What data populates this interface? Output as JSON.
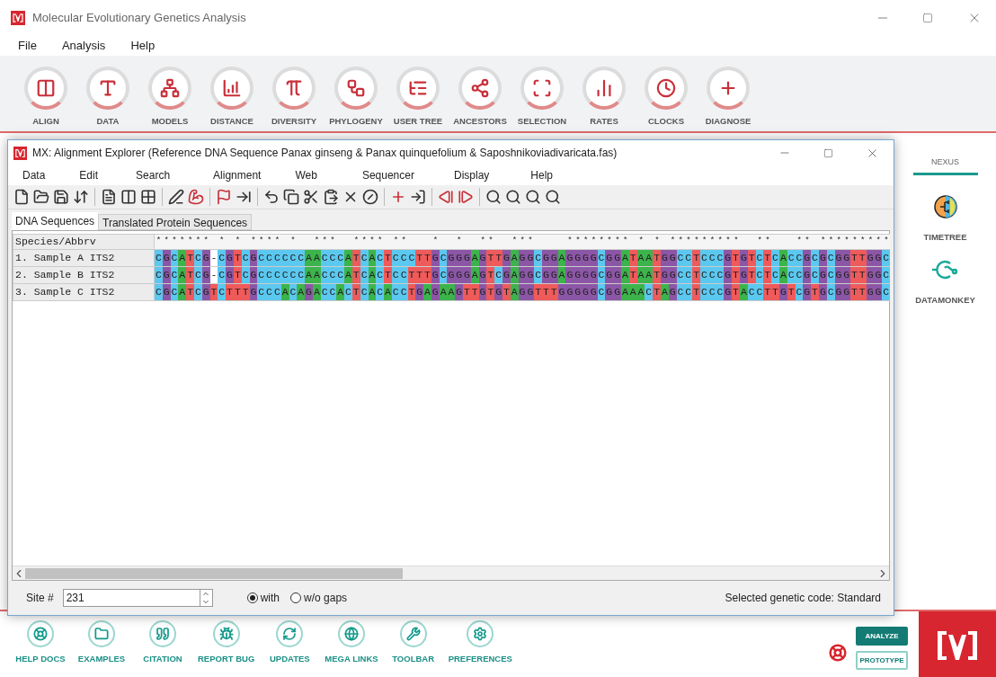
{
  "app": {
    "title": "Molecular Evolutionary Genetics Analysis",
    "menu": [
      "File",
      "Analysis",
      "Help"
    ],
    "tools": [
      "ALIGN",
      "DATA",
      "MODELS",
      "DISTANCE",
      "DIVERSITY",
      "PHYLOGENY",
      "USER TREE",
      "ANCESTORS",
      "SELECTION",
      "RATES",
      "CLOCKS",
      "DIAGNOSE"
    ]
  },
  "explorer": {
    "title": "MX: Alignment Explorer (Reference DNA Sequence Panax ginseng & Panax quinquefolium & Saposhnikoviadivaricata.fas)",
    "menu": [
      "Data",
      "Edit",
      "Search",
      "Alignment",
      "Web",
      "Sequencer",
      "Display",
      "Help"
    ],
    "tabs": [
      {
        "label": "DNA Sequences",
        "selected": true
      },
      {
        "label": "Translated Protein Sequences",
        "selected": false
      }
    ],
    "header": "Species/Abbrv",
    "conservation": "******* * * **** *  ***  **** **   *  *  **  ***    ******** * * *********  **   ** *********",
    "rows": [
      {
        "name": "1. Sample A ITS2",
        "sequence": "CGCATCG-CGTCGCCCCCCAACCCATCACTCCCTTGCGGGAGTTGAGGCGGAGGGGCGGATAATGGCCTCCCGTGTCTCACCGCGCGGTTGGC"
      },
      {
        "name": "2. Sample B ITS2",
        "sequence": "CGCATCG-CGTCGCCCCCCAACCCATCACTCCTTTGCGGGAGTCGAGGCGGAGGGGCGGATAATGGCCTCCCGTGTCTCACCGCGCGGTTGGC"
      },
      {
        "name": "3. Sample C ITS2",
        "sequence": "CGCATCGTCTTTGCCCACAGACCACTCACACCTGAGAAGTTGTGTAGGTTTGGGGGCGGAAACTAGCCTCCCGTACCTTGTCGTGCGGTTGGC"
      }
    ],
    "site_label": "Site #",
    "site_value": "231",
    "gap_options": [
      {
        "label": "with",
        "selected": true
      },
      {
        "label": "w/o gaps",
        "selected": false
      }
    ],
    "status": "Selected genetic code: Standard"
  },
  "nexus": {
    "title": "NEXUS",
    "items": [
      "TIMETREE",
      "DATAMONKEY"
    ]
  },
  "footer": {
    "links": [
      "HELP DOCS",
      "EXAMPLES",
      "CITATION",
      "REPORT BUG",
      "UPDATES",
      "MEGA LINKS",
      "TOOLBAR",
      "PREFERENCES"
    ],
    "buttons": [
      {
        "label": "ANALYZE",
        "selected": true
      },
      {
        "label": "PROTOTYPE",
        "selected": false
      }
    ]
  }
}
